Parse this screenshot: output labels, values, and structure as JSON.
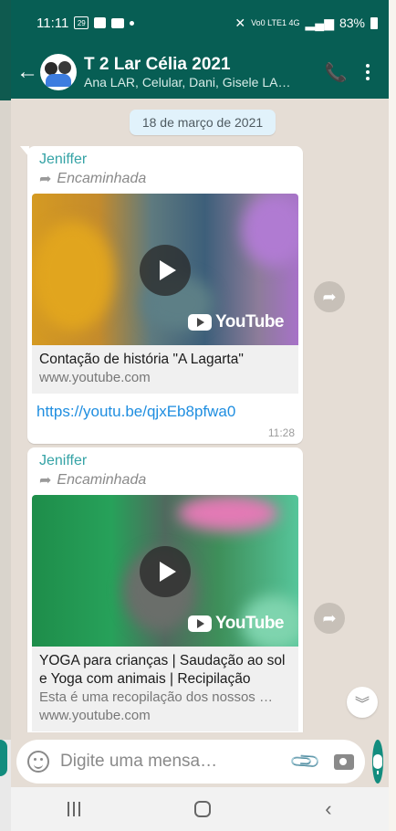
{
  "status_bar": {
    "time": "11:11",
    "network": "Vo0 LTE1 4G",
    "battery": "83%"
  },
  "app_bar": {
    "title": "T 2 Lar Célia 2021",
    "members": "Ana LAR, Celular, Dani, Gisele LA…",
    "icons": [
      "back-arrow-icon",
      "add-call-icon",
      "more-vert-icon"
    ]
  },
  "chat": {
    "date_chip": "18 de março de 2021",
    "messages": [
      {
        "sender": "Jeniffer",
        "forwarded": "Encaminhada",
        "preview_brand": "YouTube",
        "link_title": "Contação de história \"A Lagarta\"",
        "link_domain": "www.youtube.com",
        "url": "https://youtu.be/qjxEb8pfwa0",
        "time": "11:28"
      },
      {
        "sender": "Jeniffer",
        "forwarded": "Encaminhada",
        "preview_brand": "YouTube",
        "link_title": "YOGA para crianças | Saudação ao sol e Yoga com animais | Recipilação",
        "link_desc": "Esta é uma recopilação dos nossos …",
        "link_domain": "www.youtube.com"
      }
    ]
  },
  "composer": {
    "placeholder": "Digite uma mensa…"
  },
  "colors": {
    "header": "#075e54",
    "accent": "#128c7e",
    "link": "#1f8ee0",
    "sender": "#35a3a6",
    "chat_bg": "#e5ddd5"
  }
}
